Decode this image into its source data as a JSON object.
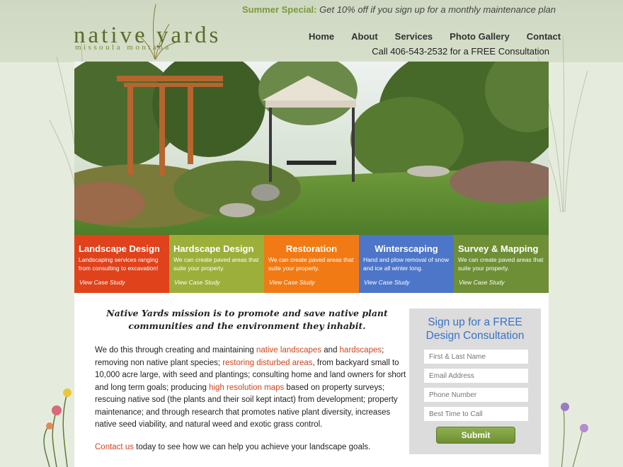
{
  "promo": {
    "lead": "Summer Special:",
    "text": "Get 10% off if you sign up for a monthly maintenance plan"
  },
  "logo": {
    "main": "native yards",
    "sub": "missoula montana"
  },
  "nav": {
    "items": [
      "Home",
      "About",
      "Services",
      "Photo Gallery",
      "Contact"
    ]
  },
  "phone": "Call 406-543-2532 for a FREE Consultation",
  "tiles": [
    {
      "title": "Landscape Design",
      "desc": "Landscaping services ranging from consulting to excavation!",
      "link": "View Case Study",
      "color": "#e0421b"
    },
    {
      "title": "Hardscape Design",
      "desc": "We can create paved areas that suite your property.",
      "link": "View Case Study",
      "color": "#9caf3a"
    },
    {
      "title": "Restoration",
      "desc": "We can create paved areas that suite your property.",
      "link": "View Case Study",
      "color": "#f27a14"
    },
    {
      "title": "Winterscaping",
      "desc": "Hand and plow removal of snow and ice all winter long.",
      "link": "View Case Study",
      "color": "#4d76c9"
    },
    {
      "title": "Survey & Mapping",
      "desc": "We can create paved areas that suite your property.",
      "link": "View Case Study",
      "color": "#6e8f35"
    }
  ],
  "mission": "Native Yards mission is to promote and save native plant communities and the environment they inhabit.",
  "body": {
    "p1": "We do this through creating and maintaining ",
    "link_native": "native landscapes",
    "p2": " and ",
    "link_hardscapes": "hardscapes",
    "p3": "; removing non native plant species; ",
    "link_restoring": "restoring disturbed areas",
    "p4": ", from backyard small to 10,000 acre large, with seed and plantings;  consulting home and land owners for short and long term goals; producing ",
    "link_maps": "high resolution maps",
    "p5": " based on property surveys; rescuing native sod (the plants and their soil kept intact) from development; property maintenance; and through research that promotes native plant diversity, increases native seed viability, and natural weed and exotic grass control."
  },
  "contact": {
    "link": "Contact us",
    "text": " today to see how we can help you achieve your landscape goals."
  },
  "form": {
    "title": "Sign up for a FREE Design Consultation",
    "name_placeholder": "First & Last Name",
    "email_placeholder": "Email Address",
    "phone_placeholder": "Phone Number",
    "time_placeholder": "Best Time to Call",
    "submit_label": "Submit"
  },
  "colors": {
    "accent_green": "#7c9a3a",
    "link_red": "#d0451b",
    "form_blue": "#3a72c4"
  }
}
